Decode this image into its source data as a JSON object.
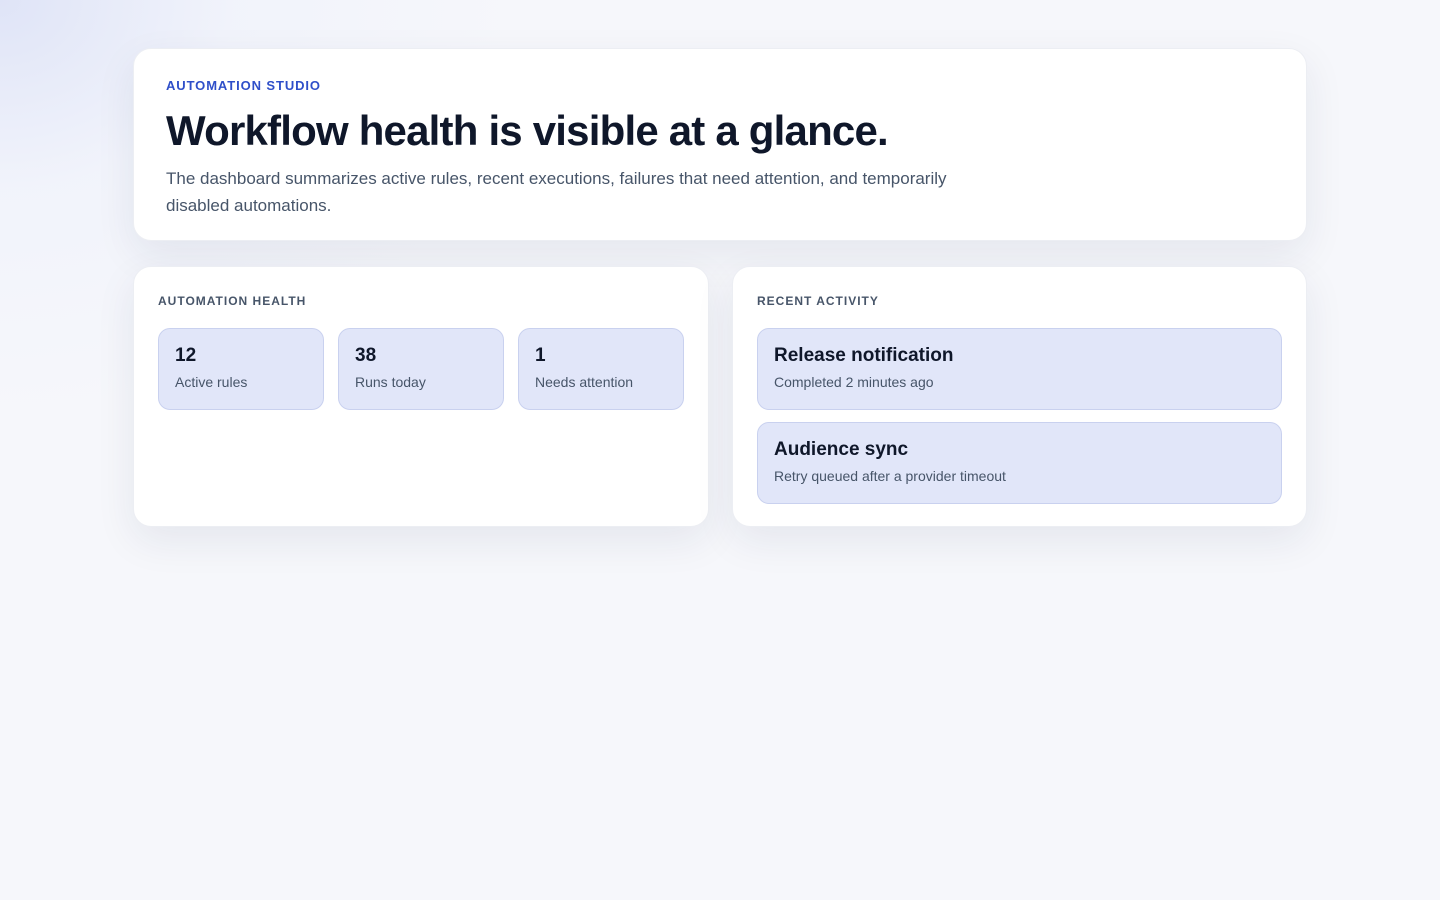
{
  "hero": {
    "eyebrow": "AUTOMATION STUDIO",
    "title": "Workflow health is visible at a glance.",
    "description": "The dashboard summarizes active rules, recent executions, failures that need attention, and temporarily disabled automations."
  },
  "health": {
    "title": "AUTOMATION HEALTH",
    "stats": [
      {
        "value": "12",
        "label": "Active rules"
      },
      {
        "value": "38",
        "label": "Runs today"
      },
      {
        "value": "1",
        "label": "Needs attention"
      }
    ]
  },
  "activity": {
    "title": "RECENT ACTIVITY",
    "items": [
      {
        "name": "Release notification",
        "status": "Completed 2 minutes ago"
      },
      {
        "name": "Audience sync",
        "status": "Retry queued after a provider timeout"
      }
    ]
  },
  "colors": {
    "accent": "#2f4fc9",
    "tile_bg": "#e1e6f9",
    "tile_border": "#c9d1ef",
    "text_primary": "#0f172a",
    "text_secondary": "#475569"
  }
}
